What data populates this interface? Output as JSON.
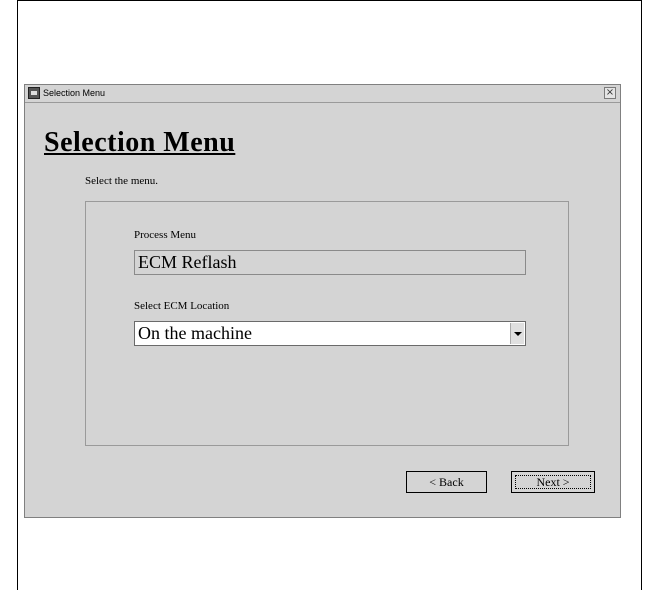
{
  "window": {
    "title": "Selection Menu",
    "close_glyph": "×"
  },
  "page": {
    "heading": "Selection Menu",
    "instruction": "Select the menu."
  },
  "process_menu": {
    "label": "Process Menu",
    "value": "ECM Reflash"
  },
  "ecm_location": {
    "label": "Select ECM Location",
    "selected": "On the machine"
  },
  "buttons": {
    "back": "< Back",
    "next": "Next >"
  },
  "icons": {
    "app": "app-icon",
    "close": "close-icon",
    "dropdown": "chevron-down-icon"
  }
}
